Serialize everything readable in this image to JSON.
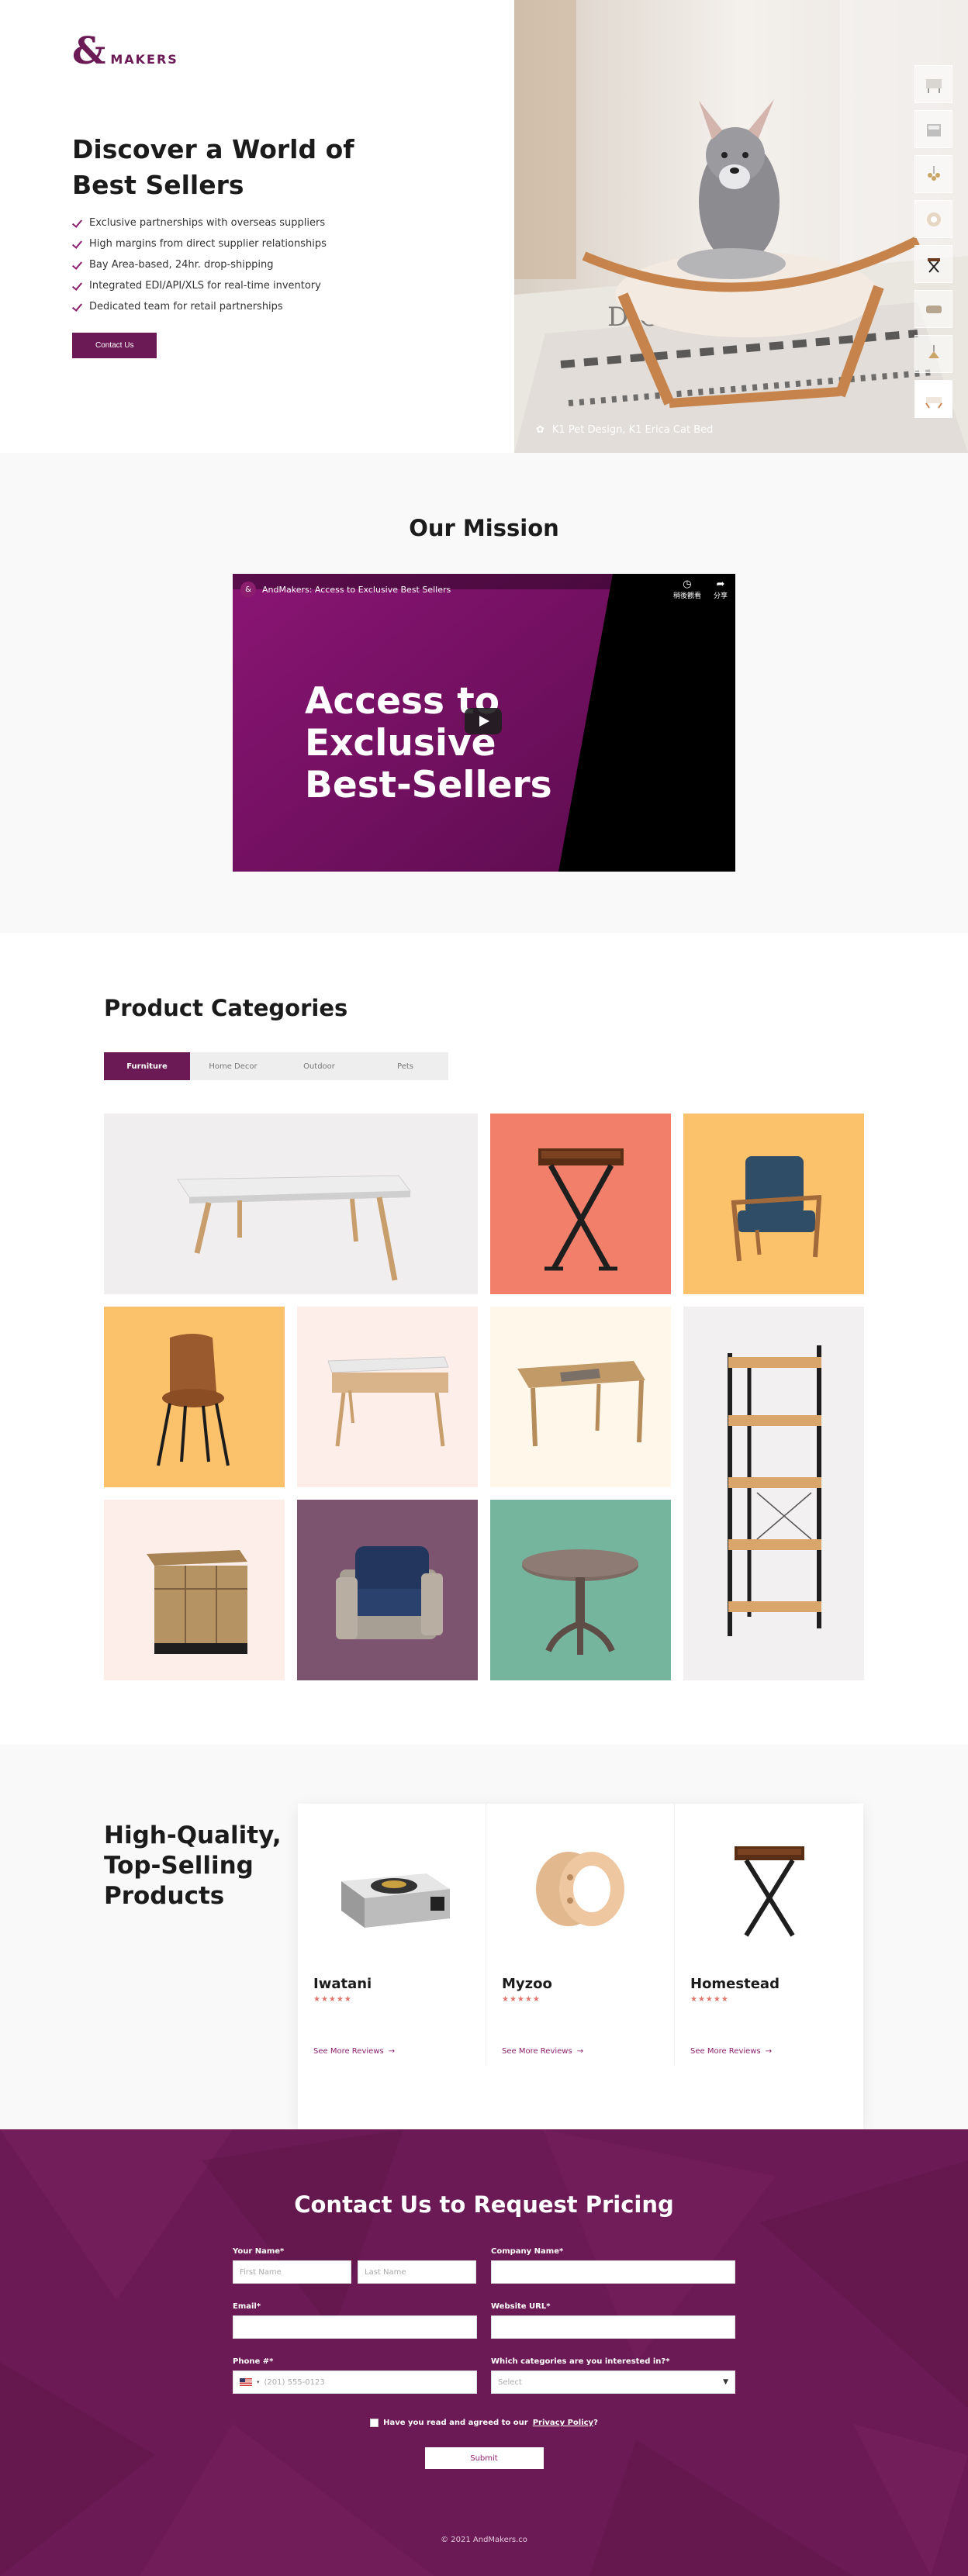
{
  "brand": {
    "amp": "&",
    "name": "MAKERS"
  },
  "hero": {
    "title": "Discover a World of Best Sellers",
    "bullets": [
      "Exclusive partnerships with overseas suppliers",
      "High margins from direct supplier relationships",
      "Bay Area-based, 24hr. drop-shipping",
      "Integrated EDI/API/XLS for real-time inventory",
      "Dedicated team for retail partnerships"
    ],
    "cta": "Contact Us",
    "caption": "K1 Pet Design, K1 Erica Cat Bed"
  },
  "mission": {
    "title": "Our Mission",
    "video_title": "AndMakers: Access to Exclusive Best Sellers",
    "watch_later": "稍後觀看",
    "share": "分享",
    "headline_1": "Access to",
    "headline_2": "Exclusive",
    "headline_3": "Best-Sellers"
  },
  "categories": {
    "title": "Product Categories",
    "tabs": [
      "Furniture",
      "Home Decor",
      "Outdoor",
      "Pets"
    ],
    "active_tab": "Furniture",
    "tile_colors": [
      "#f0eeee",
      "#f27f6a",
      "#fcc26b",
      "#fcc26b",
      "#fdeeea",
      "#fef7ea",
      "#f2f0f0",
      "#fdeeea",
      "#7c5470",
      "#75b59e"
    ]
  },
  "products": {
    "title": "High-Quality, Top-Selling Products",
    "items": [
      {
        "name": "Iwatani",
        "stars": "★★★★★",
        "link": "See More Reviews"
      },
      {
        "name": "Myzoo",
        "stars": "★★★★★",
        "link": "See More Reviews"
      },
      {
        "name": "Homestead",
        "stars": "★★★★★",
        "link": "See More Reviews"
      }
    ]
  },
  "contact": {
    "title": "Contact Us to Request Pricing",
    "your_name_label": "Your Name*",
    "first_name_placeholder": "First Name",
    "last_name_placeholder": "Last Name",
    "company_label": "Company Name*",
    "email_label": "Email*",
    "website_label": "Website URL*",
    "phone_label": "Phone #*",
    "phone_placeholder": "(201) 555-0123",
    "categories_label": "Which categories are you interested in?*",
    "select_placeholder": "Select",
    "agree_text": "Have you read and agreed to our",
    "privacy_link": "Privacy Policy",
    "agree_end": "?",
    "submit": "Submit"
  },
  "footer": {
    "copyright": "© 2021 AndMakers.co"
  },
  "colors": {
    "brand": "#6b1a55",
    "accent": "#8b1f6d",
    "stars": "#e4746b"
  }
}
